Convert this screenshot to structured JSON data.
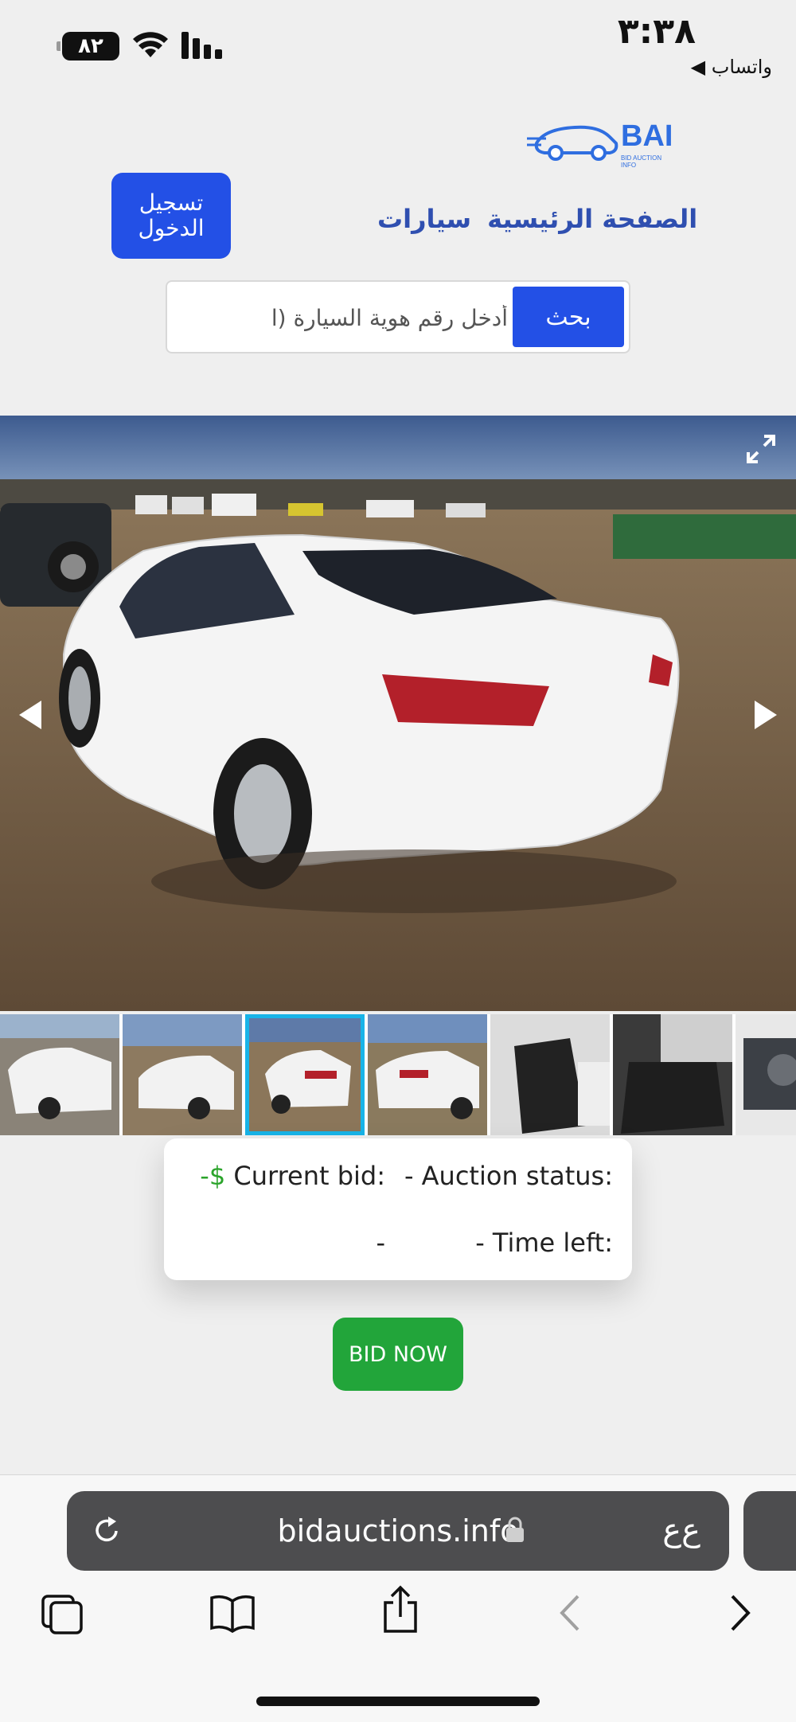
{
  "status_bar": {
    "time": "٣:٣٨",
    "battery": "٨٢",
    "back_app": "◀ واتساب"
  },
  "header": {
    "logo_text": "BAI",
    "logo_subtext": "BID AUCTION INFO",
    "login_label": "تسجيل الدخول",
    "nav": [
      "الصفحة الرئيسية",
      "سيارات"
    ]
  },
  "search": {
    "button_label": "بحث",
    "placeholder": "أدخل رقم هوية السيارة (ا"
  },
  "gallery": {
    "thumbnails": [
      "front-left damaged",
      "front-left",
      "rear-left",
      "rear-right",
      "interior front seat",
      "interior rear seat",
      "engine bay"
    ],
    "active_index": 2
  },
  "info": {
    "auction_status_label": "Auction status:",
    "auction_status_value": "-",
    "current_bid_label": "Current bid:",
    "current_bid_value": "-$",
    "time_left_label": "Time left:",
    "time_left_value": "-",
    "extra_value": "-"
  },
  "bid_button": "BID NOW",
  "browser": {
    "url": "bidauctions.info",
    "aa_label": "ع‌ع"
  },
  "colors": {
    "brand_blue": "#2350e6",
    "bid_green": "#22a53a",
    "active_thumb": "#18b4e8"
  }
}
